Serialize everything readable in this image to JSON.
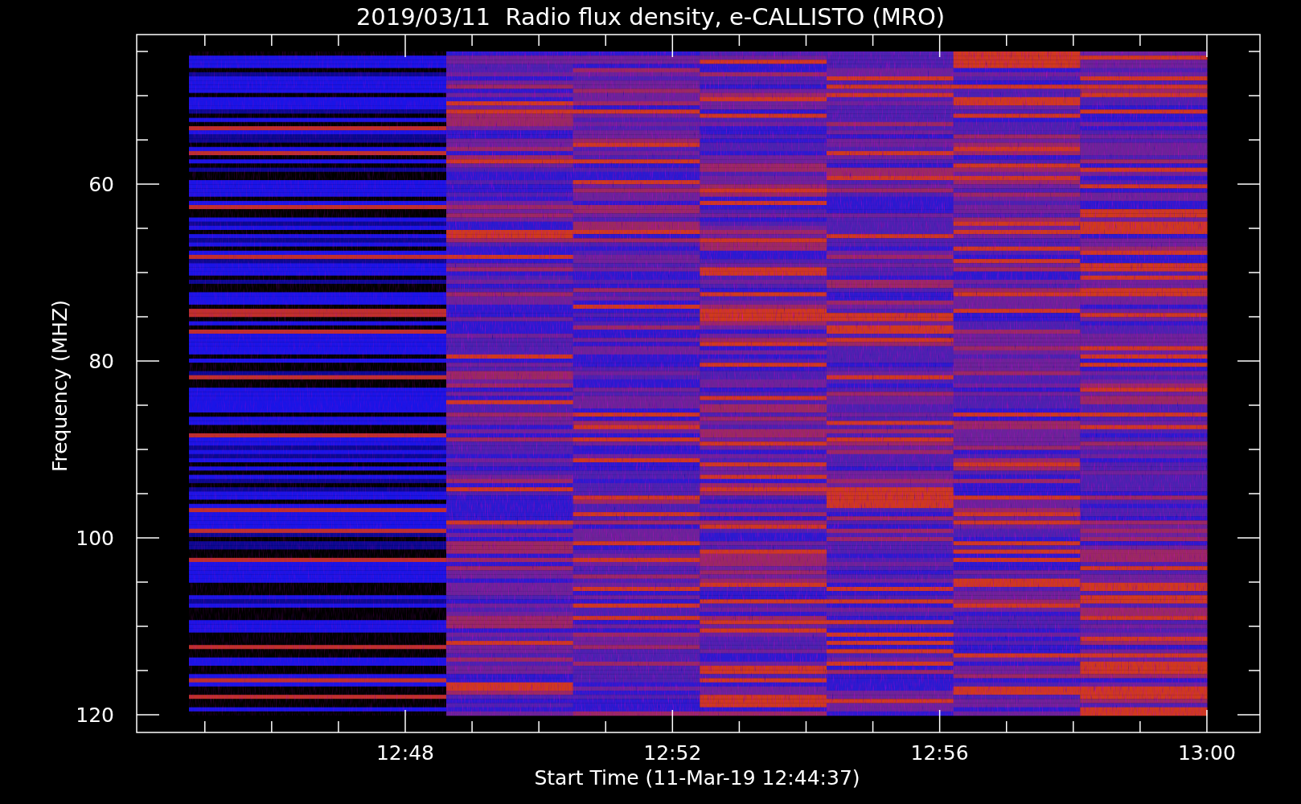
{
  "title": "2019/03/11  Radio flux density, e-CALLISTO (MRO)",
  "y_axis": {
    "label": "Frequency (MHZ)",
    "ticks": [
      "60",
      "80",
      "100",
      "120"
    ]
  },
  "x_axis": {
    "label": "Start Time (11-Mar-19 12:44:37)",
    "ticks": [
      "12:48",
      "12:52",
      "12:56",
      "13:00"
    ]
  }
}
